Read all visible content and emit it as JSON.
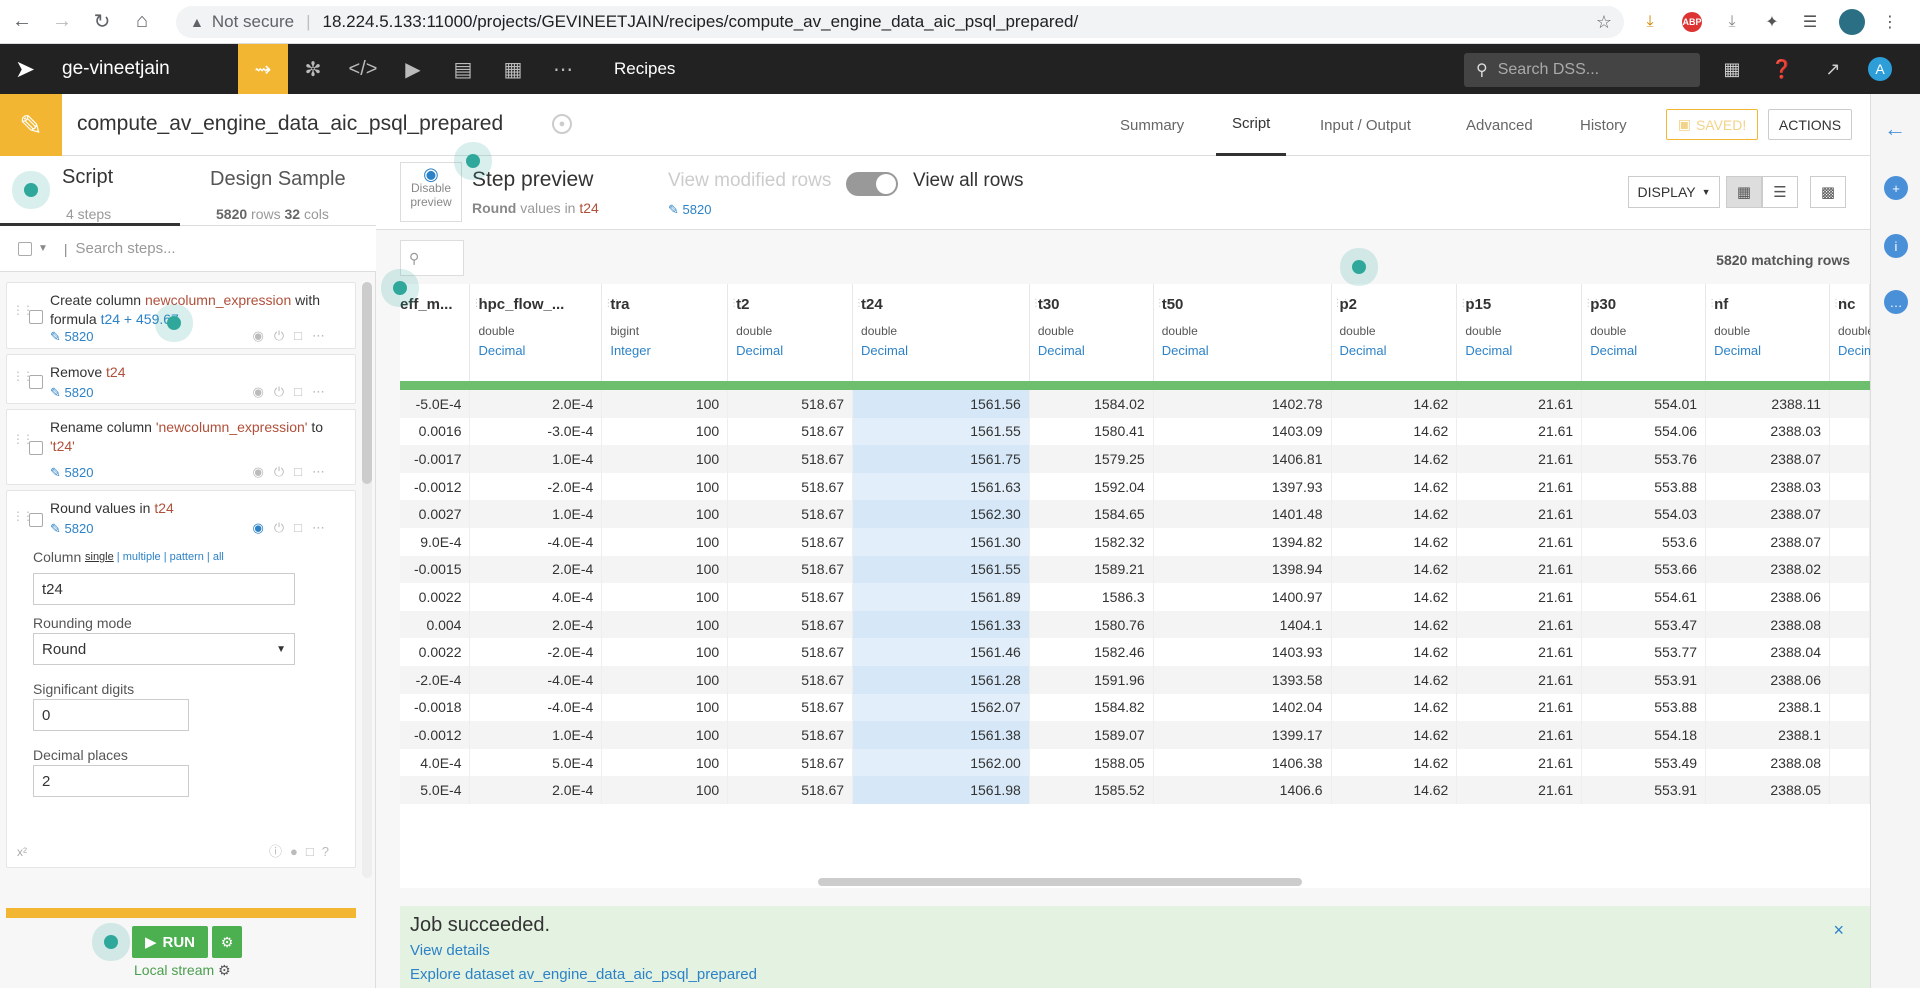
{
  "browser": {
    "not_secure": "Not secure",
    "url": "18.224.5.133:11000/projects/GEVINEETJAIN/recipes/compute_av_engine_data_aic_psql_prepared/"
  },
  "nav": {
    "project": "ge-vineetjain",
    "recipes": "Recipes",
    "search_placeholder": "Search DSS...",
    "avatar": "A"
  },
  "header": {
    "title": "compute_av_engine_data_aic_psql_prepared",
    "tabs": [
      "Summary",
      "Script",
      "Input / Output",
      "Advanced",
      "History"
    ],
    "active_tab": "Script",
    "saved": "SAVED!",
    "actions": "ACTIONS"
  },
  "left": {
    "script_tab": "Script",
    "script_sub": "4 steps",
    "design_tab": "Design Sample",
    "design_rows": "5820",
    "design_rows_suffix": " rows ",
    "design_cols": "32",
    "design_cols_suffix": " cols",
    "search_placeholder": "Search steps...",
    "steps": [
      {
        "parts": [
          "Create column ",
          "newcolumn_expression",
          " with formula ",
          "t24 + 459.67"
        ],
        "count": "5820"
      },
      {
        "parts": [
          "Remove ",
          "t24"
        ],
        "count": "5820"
      },
      {
        "parts": [
          "Rename column ",
          "'newcolumn_expression'",
          " to ",
          "'t24'"
        ],
        "count": "5820"
      },
      {
        "parts": [
          "Round",
          " values in ",
          "t24"
        ],
        "count": "5820"
      }
    ],
    "form": {
      "column_label": "Column",
      "modes": [
        "single",
        "multiple",
        "pattern",
        "all"
      ],
      "column_value": "t24",
      "rounding_label": "Rounding mode",
      "rounding_value": "Round",
      "sig_label": "Significant digits",
      "sig_value": "0",
      "dec_label": "Decimal places",
      "dec_value": "2"
    },
    "run": "RUN",
    "engine": "Local stream"
  },
  "toolbar": {
    "disable_preview": [
      "Disable",
      "preview"
    ],
    "step_preview": "Step preview",
    "step_desc_bold": "Round",
    "step_desc_mid": " values in ",
    "step_desc_col": "t24",
    "view_modified": "View modified rows",
    "view_modified_count": "5820",
    "view_all": "View all rows",
    "display": "DISPLAY",
    "matching": "5820 matching rows"
  },
  "grid": {
    "columns": [
      {
        "name": "eff_m...",
        "type": "",
        "meaning": ""
      },
      {
        "name": "hpc_flow_...",
        "type": "double",
        "meaning": "Decimal"
      },
      {
        "name": "tra",
        "type": "bigint",
        "meaning": "Integer"
      },
      {
        "name": "t2",
        "type": "double",
        "meaning": "Decimal"
      },
      {
        "name": "t24",
        "type": "double",
        "meaning": "Decimal"
      },
      {
        "name": "t30",
        "type": "double",
        "meaning": "Decimal"
      },
      {
        "name": "t50",
        "type": "double",
        "meaning": "Decimal"
      },
      {
        "name": "p2",
        "type": "double",
        "meaning": "Decimal"
      },
      {
        "name": "p15",
        "type": "double",
        "meaning": "Decimal"
      },
      {
        "name": "p30",
        "type": "double",
        "meaning": "Decimal"
      },
      {
        "name": "nf",
        "type": "double",
        "meaning": "Decimal"
      },
      {
        "name": "nc",
        "type": "double",
        "meaning": "Decim"
      }
    ],
    "rows": [
      [
        "-5.0E-4",
        "2.0E-4",
        "100",
        "518.67",
        "1561.56",
        "1584.02",
        "1402.78",
        "14.62",
        "21.61",
        "554.01",
        "2388.11",
        ""
      ],
      [
        "0.0016",
        "-3.0E-4",
        "100",
        "518.67",
        "1561.55",
        "1580.41",
        "1403.09",
        "14.62",
        "21.61",
        "554.06",
        "2388.03",
        ""
      ],
      [
        "-0.0017",
        "1.0E-4",
        "100",
        "518.67",
        "1561.75",
        "1579.25",
        "1406.81",
        "14.62",
        "21.61",
        "553.76",
        "2388.07",
        ""
      ],
      [
        "-0.0012",
        "-2.0E-4",
        "100",
        "518.67",
        "1561.63",
        "1592.04",
        "1397.93",
        "14.62",
        "21.61",
        "553.88",
        "2388.03",
        ""
      ],
      [
        "0.0027",
        "1.0E-4",
        "100",
        "518.67",
        "1562.30",
        "1584.65",
        "1401.48",
        "14.62",
        "21.61",
        "554.03",
        "2388.07",
        ""
      ],
      [
        "9.0E-4",
        "-4.0E-4",
        "100",
        "518.67",
        "1561.30",
        "1582.32",
        "1394.82",
        "14.62",
        "21.61",
        "553.6",
        "2388.07",
        ""
      ],
      [
        "-0.0015",
        "2.0E-4",
        "100",
        "518.67",
        "1561.55",
        "1589.21",
        "1398.94",
        "14.62",
        "21.61",
        "553.66",
        "2388.02",
        ""
      ],
      [
        "0.0022",
        "4.0E-4",
        "100",
        "518.67",
        "1561.89",
        "1586.3",
        "1400.97",
        "14.62",
        "21.61",
        "554.61",
        "2388.06",
        ""
      ],
      [
        "0.004",
        "2.0E-4",
        "100",
        "518.67",
        "1561.33",
        "1580.76",
        "1404.1",
        "14.62",
        "21.61",
        "553.47",
        "2388.08",
        ""
      ],
      [
        "0.0022",
        "-2.0E-4",
        "100",
        "518.67",
        "1561.46",
        "1582.46",
        "1403.93",
        "14.62",
        "21.61",
        "553.77",
        "2388.04",
        ""
      ],
      [
        "-2.0E-4",
        "-4.0E-4",
        "100",
        "518.67",
        "1561.28",
        "1591.96",
        "1393.58",
        "14.62",
        "21.61",
        "553.91",
        "2388.06",
        ""
      ],
      [
        "-0.0018",
        "-4.0E-4",
        "100",
        "518.67",
        "1562.07",
        "1584.82",
        "1402.04",
        "14.62",
        "21.61",
        "553.88",
        "2388.1",
        ""
      ],
      [
        "-0.0012",
        "1.0E-4",
        "100",
        "518.67",
        "1561.38",
        "1589.07",
        "1399.17",
        "14.62",
        "21.61",
        "554.18",
        "2388.1",
        ""
      ],
      [
        "4.0E-4",
        "5.0E-4",
        "100",
        "518.67",
        "1562.00",
        "1588.05",
        "1406.38",
        "14.62",
        "21.61",
        "553.49",
        "2388.08",
        ""
      ],
      [
        "5.0E-4",
        "2.0E-4",
        "100",
        "518.67",
        "1561.98",
        "1585.52",
        "1406.6",
        "14.62",
        "21.61",
        "553.91",
        "2388.05",
        ""
      ]
    ]
  },
  "job": {
    "title": "Job succeeded.",
    "details": "View details",
    "explore": "Explore dataset av_engine_data_aic_psql_prepared",
    "close": "×"
  },
  "colors": {
    "accent": "#f2b632",
    "link": "#2d82c7",
    "success": "#4caf50",
    "highlight_col": "#e2effa"
  }
}
